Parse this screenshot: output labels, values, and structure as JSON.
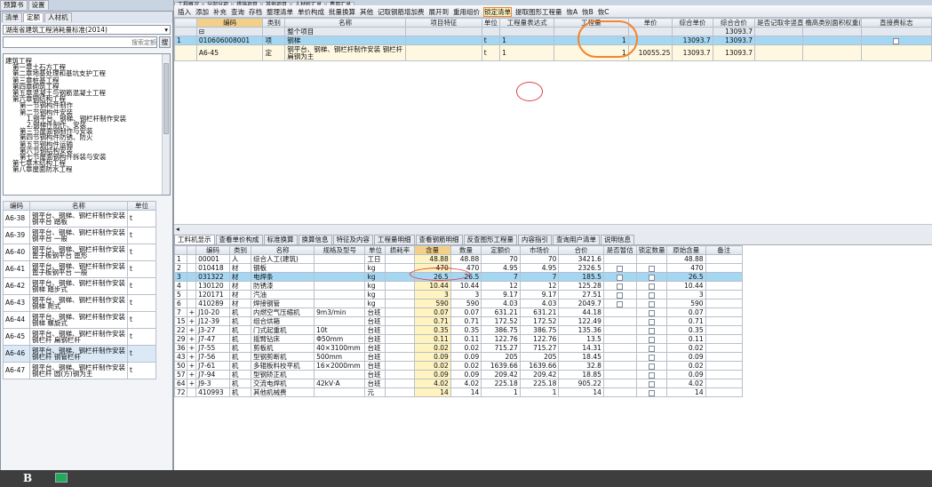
{
  "top_tabs": [
    "工程概况",
    "分部分项",
    "措施项目",
    "其他项目",
    "人材机汇总",
    "费用汇总"
  ],
  "top_left_tabs": [
    "预算书",
    "设置"
  ],
  "left_tabs": [
    "清单",
    "定额",
    "人材机"
  ],
  "quota_lib": "湖南省建筑工程消耗量标准(2014)",
  "search_placeholder": "搜索定额",
  "search_btn": "搜",
  "tree": [
    "建筑工程",
    "第一章土石方工程",
    "第二章地基处理和基坑支护工程",
    "第三章桩基工程",
    "第四章砌筑工程",
    "第五章混凝土与钢筋混凝土工程",
    "第六章钢结构工程",
    "第一节钢构件制作",
    "第二节钢构件安装",
    "1.钢平台、钢梯、钢栏杆制作安装",
    "2.钢梯件制作、安装",
    "第三节屋面钢制作与安装",
    "第四节钢构件防锈、防火",
    "第五节钢构件运输",
    "第六节钢结构安装",
    "第七节屋面钢构件拆装与安装",
    "第七章木结构工程",
    "第八章屋面防水工程"
  ],
  "quota_list": {
    "headers": [
      "编码",
      "名称",
      "单位"
    ],
    "rows": [
      [
        "A6-38",
        "钢平台、钢梯、钢栏杆制作安装 钢平台 踏板",
        "t"
      ],
      [
        "A6-39",
        "钢平台、钢梯、钢栏杆制作安装 钢平台 一般",
        "t"
      ],
      [
        "A6-40",
        "钢平台、钢梯、钢栏杆制作安装 篦子板钢平台 篦形",
        "t"
      ],
      [
        "A6-41",
        "钢平台、钢梯、钢栏杆制作安装 篦子板钢平台 一般",
        "t"
      ],
      [
        "A6-42",
        "钢平台、钢梯、钢栏杆制作安装 钢梯 踏步式",
        "t"
      ],
      [
        "A6-43",
        "钢平台、钢梯、钢栏杆制作安装 钢梯 爬式",
        "t"
      ],
      [
        "A6-44",
        "钢平台、钢梯、钢栏杆制作安装 钢梯 螺旋式",
        "t"
      ],
      [
        "A6-45",
        "钢平台、钢梯、钢栏杆制作安装 钢栏杆 扁钢栏杆",
        "t"
      ],
      [
        "A6-46",
        "钢平台、钢梯、钢栏杆制作安装 钢栏杆 钢管栏杆",
        "t"
      ],
      [
        "A6-47",
        "钢平台、钢梯、钢栏杆制作安装 钢栏杆 圆(方)钢为主",
        "t"
      ]
    ]
  },
  "toolbar": [
    "插入",
    "添加",
    "补充",
    "查询",
    "存档",
    "整理清单",
    "单价构成",
    "批量换算",
    "其他",
    "记取钢筋增加费",
    "展开到",
    "重用组价",
    "锁定清单",
    "提取图形工程量",
    "恢A",
    "恢B",
    "恢C"
  ],
  "main": {
    "headers": [
      "编码",
      "类别",
      "名称",
      "项目特征",
      "单位",
      "工程量表达式",
      "工程量",
      "单价",
      "综合单价",
      "综合合价",
      "是否记取非竖直运输",
      "檐高类别面积权重(%)",
      "直接费标志"
    ],
    "total_label": "整个项目",
    "total": "13093.7",
    "rows": [
      {
        "n": "1",
        "code": "010606008001",
        "type": "项",
        "name": "钢梯",
        "unit": "t",
        "expr": "1",
        "qty": "1",
        "price": "",
        "unit_price": "13093.7",
        "total": "13093.7"
      },
      {
        "n": "",
        "code": "A6-45",
        "type": "定",
        "name": "钢平台、钢梯、钢栏杆制作安装 钢栏杆 扁钢为主",
        "unit": "t",
        "expr": "1",
        "qty": "1",
        "price": "10055.25",
        "unit_price": "13093.7",
        "total": "13093.7"
      }
    ]
  },
  "bottom_tabs": [
    "工料机显示",
    "查看单价构成",
    "标准换算",
    "换算信息",
    "特征及内容",
    "工程量明细",
    "查看钢筋明细",
    "反查图形工程量",
    "内容指引",
    "查询用户清单",
    "说明信息"
  ],
  "bottom": {
    "headers": [
      "编码",
      "类别",
      "名称",
      "规格及型号",
      "单位",
      "损耗率",
      "含量",
      "数量",
      "定额价",
      "市场价",
      "合价",
      "是否暂估",
      "锁定数量",
      "原始含量",
      "备注"
    ],
    "rows": [
      [
        "1",
        "",
        "00001",
        "人",
        "综合人工(建筑)",
        "",
        "工日",
        "",
        "48.88",
        "48.88",
        "70",
        "70",
        "3421.6",
        "",
        "",
        "48.88"
      ],
      [
        "2",
        "",
        "010418",
        "材",
        "钢板",
        "",
        "kg",
        "",
        "470",
        "470",
        "4.95",
        "4.95",
        "2326.5",
        "c",
        "c",
        "470"
      ],
      [
        "3",
        "",
        "031322",
        "材",
        "电焊条",
        "",
        "kg",
        "",
        "26.5",
        "26.5",
        "7",
        "7",
        "185.5",
        "c",
        "c",
        "26.5"
      ],
      [
        "4",
        "",
        "130120",
        "材",
        "防锈漆",
        "",
        "kg",
        "",
        "10.44",
        "10.44",
        "12",
        "12",
        "125.28",
        "c",
        "c",
        "10.44"
      ],
      [
        "5",
        "",
        "120171",
        "材",
        "汽油",
        "",
        "kg",
        "",
        "3",
        "3",
        "9.17",
        "9.17",
        "27.51",
        "c",
        "c",
        "3"
      ],
      [
        "6",
        "",
        "410289",
        "材",
        "焊接钢管",
        "",
        "kg",
        "",
        "590",
        "590",
        "4.03",
        "4.03",
        "2049.7",
        "c",
        "c",
        "590"
      ],
      [
        "7",
        "+",
        "J10-20",
        "机",
        "内燃空气压缩机",
        "9m3/min",
        "台班",
        "",
        "0.07",
        "0.07",
        "631.21",
        "631.21",
        "44.18",
        "",
        "c",
        "0.07"
      ],
      [
        "15",
        "+",
        "J12-39",
        "机",
        "组合烘箱",
        "",
        "台班",
        "",
        "0.71",
        "0.71",
        "172.52",
        "172.52",
        "122.49",
        "",
        "c",
        "0.71"
      ],
      [
        "22",
        "+",
        "J3-27",
        "机",
        "门式起重机",
        "10t",
        "台班",
        "",
        "0.35",
        "0.35",
        "386.75",
        "386.75",
        "135.36",
        "",
        "c",
        "0.35"
      ],
      [
        "29",
        "+",
        "J7-47",
        "机",
        "摇臂钻床",
        "Φ50mm",
        "台班",
        "",
        "0.11",
        "0.11",
        "122.76",
        "122.76",
        "13.5",
        "",
        "c",
        "0.11"
      ],
      [
        "36",
        "+",
        "J7-55",
        "机",
        "剪板机",
        "40×3100mm",
        "台班",
        "",
        "0.02",
        "0.02",
        "715.27",
        "715.27",
        "14.31",
        "",
        "c",
        "0.02"
      ],
      [
        "43",
        "+",
        "J7-56",
        "机",
        "型钢剪断机",
        "500mm",
        "台班",
        "",
        "0.09",
        "0.09",
        "205",
        "205",
        "18.45",
        "",
        "c",
        "0.09"
      ],
      [
        "50",
        "+",
        "J7-61",
        "机",
        "多辊板料校平机",
        "16×2000mm",
        "台班",
        "",
        "0.02",
        "0.02",
        "1639.66",
        "1639.66",
        "32.8",
        "",
        "c",
        "0.02"
      ],
      [
        "57",
        "+",
        "J7-94",
        "机",
        "型钢矫正机",
        "",
        "台班",
        "",
        "0.09",
        "0.09",
        "209.42",
        "209.42",
        "18.85",
        "",
        "c",
        "0.09"
      ],
      [
        "64",
        "+",
        "J9-3",
        "机",
        "交流电焊机",
        "42kV·A",
        "台班",
        "",
        "4.02",
        "4.02",
        "225.18",
        "225.18",
        "905.22",
        "",
        "c",
        "4.02"
      ],
      [
        "72",
        "",
        "410993",
        "机",
        "其他机械费",
        "",
        "元",
        "",
        "14",
        "14",
        "1",
        "1",
        "14",
        "",
        "c",
        "14"
      ]
    ]
  },
  "status": {
    "bold_btn": "B",
    "img_btn": "image-icon"
  },
  "colors": {
    "selected_row": "#a6d7f2",
    "accent": "#f5842b",
    "highlight": "#fff3bf"
  }
}
